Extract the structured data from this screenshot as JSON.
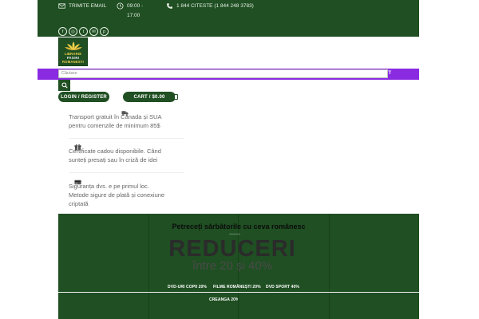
{
  "topbar": {
    "email_label": "TRIMITE EMAIL",
    "hours_line1": "09:00 -",
    "hours_line2": "17:00",
    "phone_label": "1 844 CITESTE (1 844 248 3783)"
  },
  "socials": [
    {
      "name": "facebook",
      "glyph": "f"
    },
    {
      "name": "instagram",
      "glyph": "◎"
    },
    {
      "name": "twitter",
      "glyph": "t"
    },
    {
      "name": "email",
      "glyph": "✉"
    },
    {
      "name": "pinterest",
      "glyph": "p"
    }
  ],
  "logo": {
    "line1": "LIBRARIE",
    "line2": "PAGINI",
    "line3": "ROMANESTI"
  },
  "search": {
    "placeholder": "Căutare"
  },
  "nav": {
    "tail_label": "T"
  },
  "account": {
    "login_label": "LOGIN / REGISTER",
    "cart_label": "CART / $0.00"
  },
  "features": [
    {
      "icon": "truck-icon",
      "text": "Transport gratuit în Canada și SUA pentru comenzile de minimum 85$"
    },
    {
      "icon": "gift-icon",
      "text": "Certificate cadou disponibile. Când sunteți presați sau în criză de idei"
    },
    {
      "icon": "credit-card-icon",
      "text": "Siguranța dvs. e pe primul loc. Metode sigure de plată și conexiune criptată"
    }
  ],
  "hero": {
    "headline": "Petreceți sărbătorile cu ceva românesc",
    "big": "REDUCERI",
    "sub": "între 20 și 40%",
    "links": [
      "DVD-URI COPII 20%",
      "FILME ROMÂNEȘTI 20%",
      "DVD SPORT 40%",
      "CREANGA 20%"
    ]
  },
  "colors": {
    "brand_green": "#1f4f22",
    "accent_purple": "#8a2be2",
    "logo_gold": "#f3d24a"
  }
}
